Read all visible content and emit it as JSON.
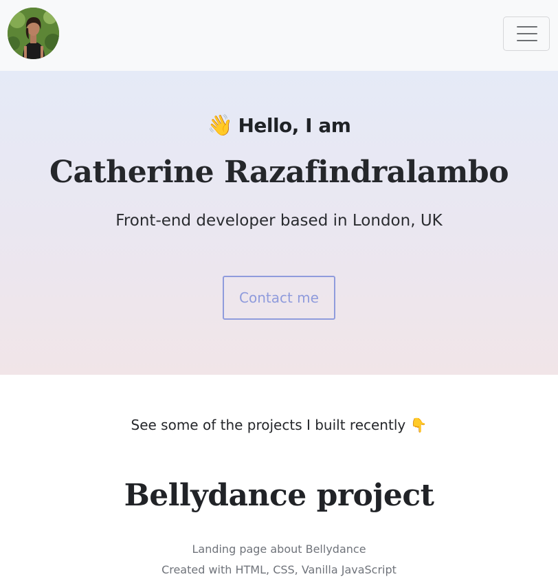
{
  "navbar": {
    "avatar_alt": "Profile photo",
    "menu_toggle_icon": "hamburger-icon"
  },
  "hero": {
    "wave_emoji": "👋",
    "greeting": "Hello, I am",
    "name": "Catherine Razafindralambo",
    "tagline": "Front-end developer based in London, UK",
    "contact_label": "Contact me"
  },
  "projects": {
    "intro": "See some of the projects I built recently",
    "pointing_emoji": "👇",
    "items": [
      {
        "title": "Bellydance project",
        "description": "Landing page about Bellydance",
        "tech": "Created with HTML, CSS, Vanilla JavaScript"
      }
    ]
  },
  "colors": {
    "navbar_bg": "#f8f9fa",
    "hero_gradient_top": "#e5eaf7",
    "hero_gradient_bottom": "#f1e5e8",
    "accent": "#8f9bdc",
    "muted_text": "#6f737a"
  }
}
